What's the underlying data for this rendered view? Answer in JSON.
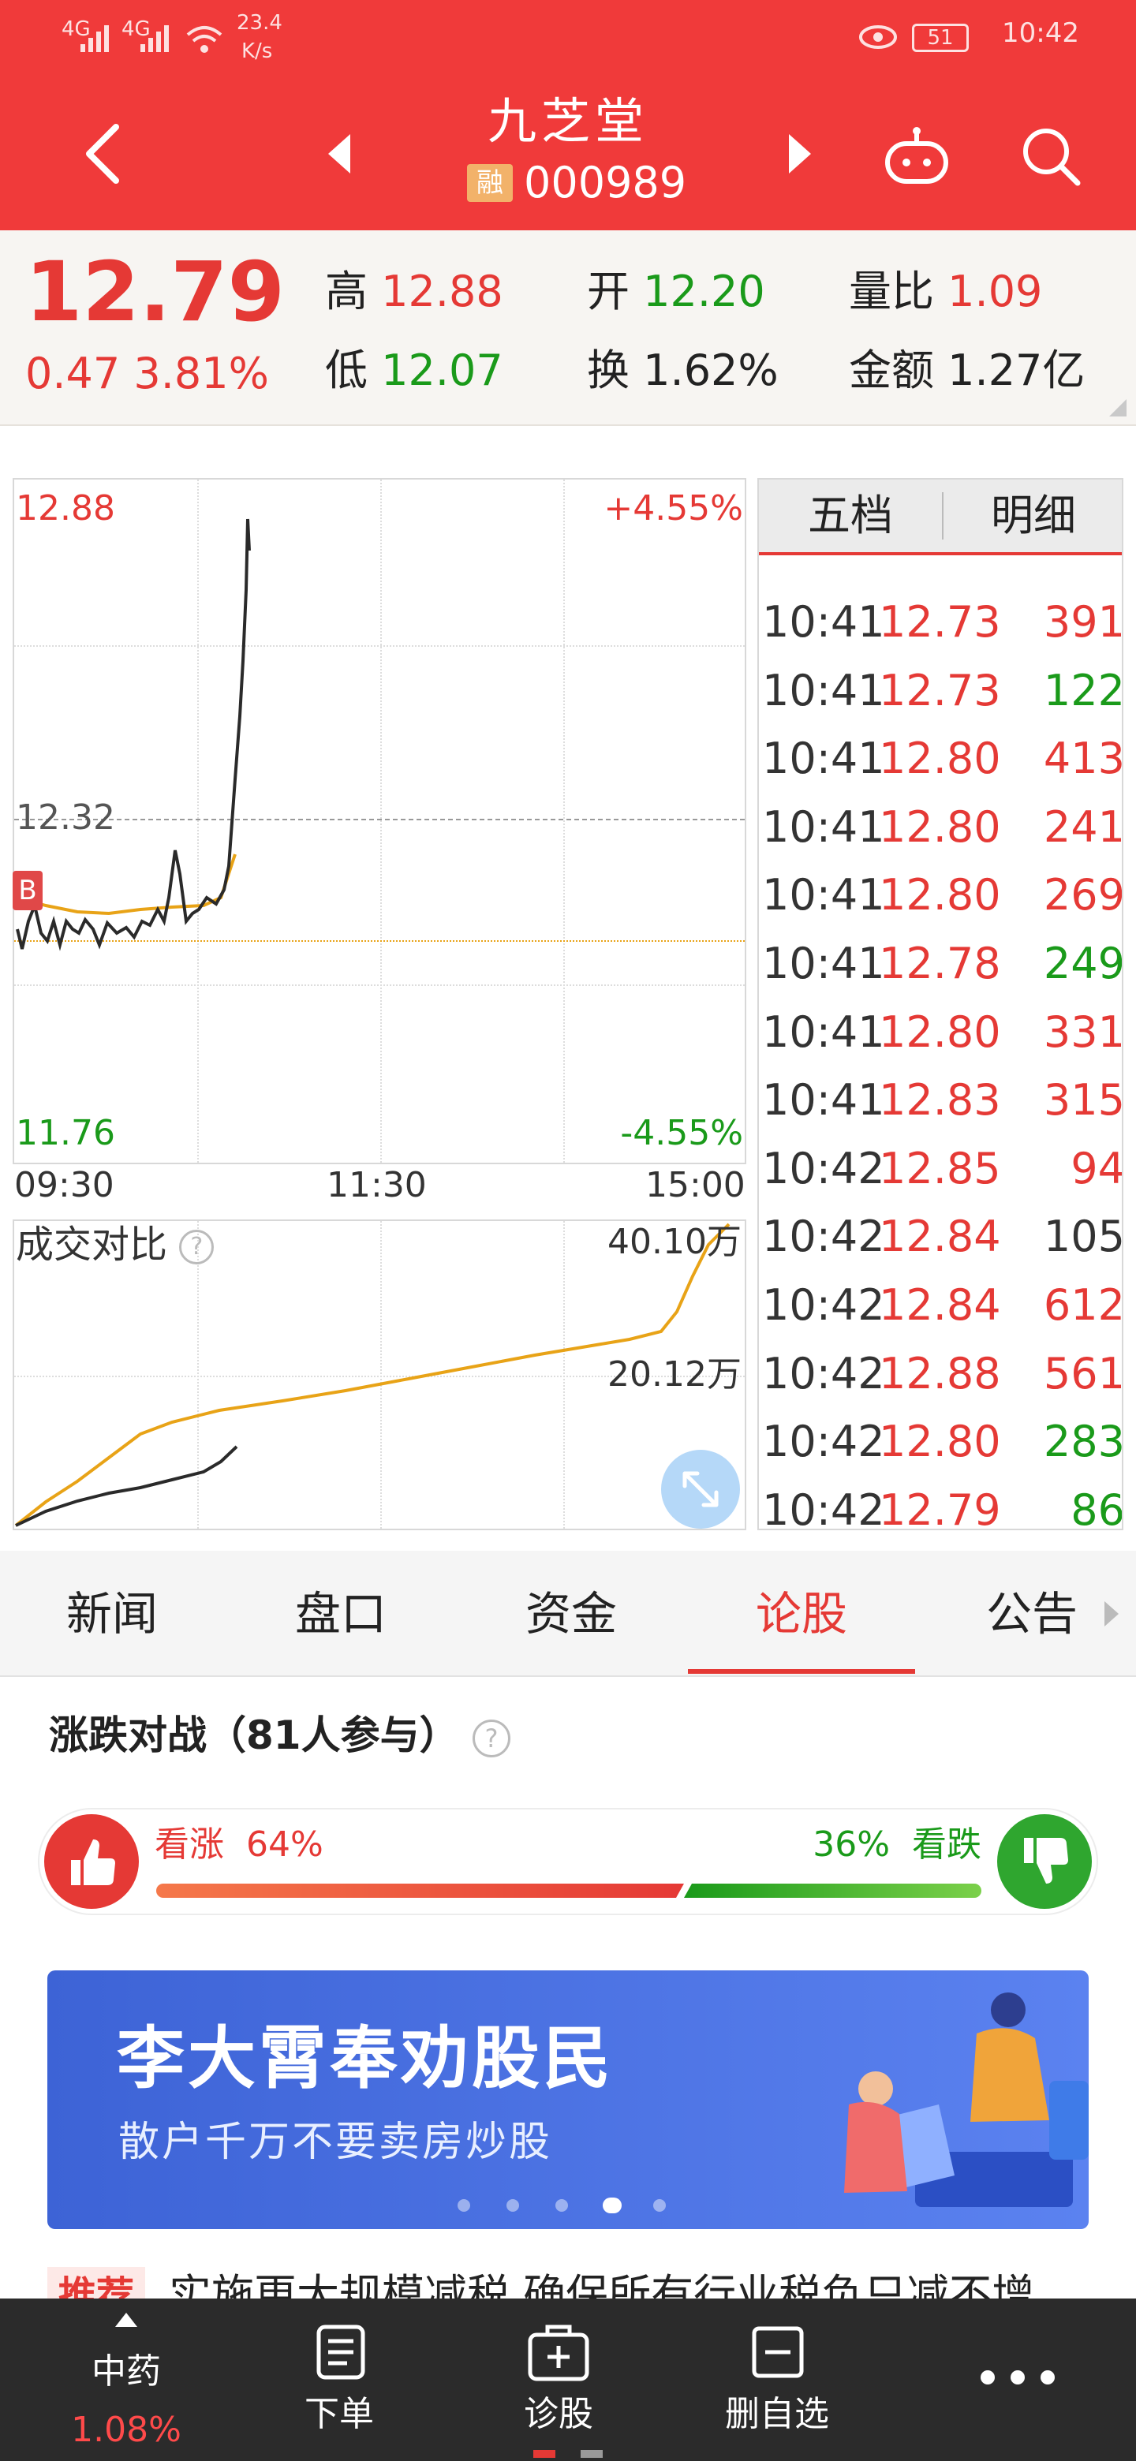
{
  "status_bar": {
    "signal_1": "4G",
    "signal_2": "4G",
    "speed": "23.4",
    "speed_unit": "K/s",
    "battery": "51",
    "time": "10:42"
  },
  "header": {
    "stock_name": "九芝堂",
    "margin_badge": "融",
    "stock_code": "000989"
  },
  "quote": {
    "price": "12.79",
    "change": "0.47",
    "change_pct": "3.81%",
    "high_label": "高",
    "high_value": "12.88",
    "low_label": "低",
    "low_value": "12.07",
    "open_label": "开",
    "open_value": "12.20",
    "turnover_label": "换",
    "turnover_value": "1.62%",
    "vol_ratio_label": "量比",
    "vol_ratio_value": "1.09",
    "amount_label": "金额",
    "amount_value": "1.27亿"
  },
  "price_chart": {
    "top_price": "12.88",
    "top_pct": "+4.55%",
    "mid_price": "12.32",
    "bottom_price": "11.76",
    "bottom_pct": "-4.55%",
    "time_start": "09:30",
    "time_mid": "11:30",
    "time_end": "15:00",
    "buy_marker": "B"
  },
  "volume_chart": {
    "title": "成交对比",
    "help_icon": "?",
    "top_value": "40.10万",
    "mid_value": "20.12万"
  },
  "trade_panel": {
    "tab_five": "五档",
    "tab_detail": "明细",
    "rows": [
      {
        "time": "10:41",
        "price": "12.73",
        "vol": "391",
        "dir": "red"
      },
      {
        "time": "10:41",
        "price": "12.73",
        "vol": "122",
        "dir": "green"
      },
      {
        "time": "10:41",
        "price": "12.80",
        "vol": "413",
        "dir": "red"
      },
      {
        "time": "10:41",
        "price": "12.80",
        "vol": "241",
        "dir": "red"
      },
      {
        "time": "10:41",
        "price": "12.80",
        "vol": "269",
        "dir": "red"
      },
      {
        "time": "10:41",
        "price": "12.78",
        "vol": "249",
        "dir": "green"
      },
      {
        "time": "10:41",
        "price": "12.80",
        "vol": "331",
        "dir": "red"
      },
      {
        "time": "10:41",
        "price": "12.83",
        "vol": "315",
        "dir": "red"
      },
      {
        "time": "10:42",
        "price": "12.85",
        "vol": "94",
        "dir": "red"
      },
      {
        "time": "10:42",
        "price": "12.84",
        "vol": "105",
        "dir": "dark"
      },
      {
        "time": "10:42",
        "price": "12.84",
        "vol": "612",
        "dir": "red"
      },
      {
        "time": "10:42",
        "price": "12.88",
        "vol": "561",
        "dir": "red"
      },
      {
        "time": "10:42",
        "price": "12.80",
        "vol": "283",
        "dir": "green"
      },
      {
        "time": "10:42",
        "price": "12.79",
        "vol": "86",
        "dir": "green"
      }
    ]
  },
  "tabs": [
    "新闻",
    "盘口",
    "资金",
    "论股",
    "公告"
  ],
  "vote": {
    "title": "涨跌对战（81人参与）",
    "bull_label": "看涨",
    "bull_pct": "64%",
    "bear_pct": "36%",
    "bear_label": "看跌",
    "bull_fraction": 0.64
  },
  "banner": {
    "headline": "李大霄奉劝股民",
    "subline": "散户千万不要卖房炒股",
    "dots": 5,
    "active_dot": 3
  },
  "news": {
    "tag": "推荐",
    "text": "实施更大规模减税 确保所有行业税负只减不增"
  },
  "bottom_bar": {
    "sector_name": "中药",
    "sector_change": "1.08%",
    "order": "下单",
    "diagnose": "诊股",
    "remove_watch": "删自选"
  },
  "colors": {
    "brand_red": "#f03a3a",
    "up_red": "#e53935",
    "down_green": "#1a9a1a",
    "avg_line": "#e8a317"
  }
}
